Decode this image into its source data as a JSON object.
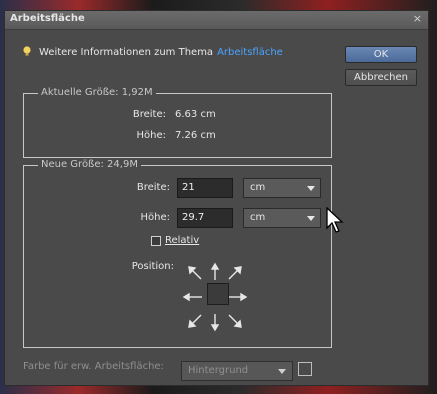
{
  "window": {
    "title": "Arbeitsfläche",
    "close_symbol": "×"
  },
  "info": {
    "text": "Weitere Informationen zum Thema",
    "link": "Arbeitsfläche"
  },
  "buttons": {
    "ok": "OK",
    "cancel": "Abbrechen"
  },
  "current_size": {
    "legend": "Aktuelle Größe: 1,92M",
    "width_label": "Breite:",
    "width_value": "6.63 cm",
    "height_label": "Höhe:",
    "height_value": "7.26 cm"
  },
  "new_size": {
    "legend": "Neue Größe: 24,9M",
    "width_label": "Breite:",
    "width_value": "21",
    "width_unit": "cm",
    "height_label": "Höhe:",
    "height_value": "29.7",
    "height_unit": "cm",
    "relative_label": "Relativ",
    "relative_checked": false,
    "position_label": "Position:"
  },
  "extension": {
    "label": "Farbe für erw. Arbeitsfläche:",
    "selected": "Hintergrund"
  },
  "colors": {
    "accent_button": "#5a78a6",
    "link": "#4aa3ff",
    "dialog_bg": "#4a4a4a"
  }
}
